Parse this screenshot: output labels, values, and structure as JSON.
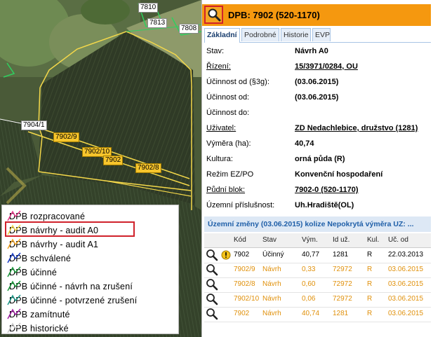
{
  "map": {
    "parcel_labels_top": [
      "7810",
      "7813",
      "7808"
    ],
    "parcel_labels_yellow": [
      "7902/9",
      "7902/10",
      "7902",
      "7902/8"
    ],
    "parcel_label_white_left": "7904/1"
  },
  "legend": {
    "items": [
      {
        "label": "DPB rozpracované",
        "color": "#e8398b"
      },
      {
        "label": "DPB návrhy - audit A0",
        "color": "#f4d84a"
      },
      {
        "label": "DPB návrhy - audit A1",
        "color": "#f5a623"
      },
      {
        "label": "DPB schválené",
        "color": "#1a3ec8"
      },
      {
        "label": "DPB účinné",
        "color": "#1c9b3c"
      },
      {
        "label": "DPB účinné - návrh na zrušení",
        "color": "#1c9b3c"
      },
      {
        "label": "DPB účinné - potvrzené zrušení",
        "color": "#1c9b8a"
      },
      {
        "label": "DPB zamítnuté",
        "color": "#a21fa6"
      },
      {
        "label": "DPB historické",
        "color": "#c8c8c8"
      }
    ]
  },
  "panel": {
    "title": "DPB: 7902 (520-1170)",
    "tabs": [
      "Základní",
      "Podrobné",
      "Historie",
      "EVP"
    ],
    "fields": [
      {
        "key": "Stav:",
        "value": "Návrh A0",
        "key_link": false,
        "val_link": false
      },
      {
        "key": "Řízení:",
        "value": "15/3971/0284, OU",
        "key_link": true,
        "val_link": true
      },
      {
        "key": "Účinnost od (§3g):",
        "value": "(03.06.2015)",
        "key_link": false,
        "val_link": false
      },
      {
        "key": "Účinnost od:",
        "value": "(03.06.2015)",
        "key_link": false,
        "val_link": false
      },
      {
        "key": "Účinnost do:",
        "value": "",
        "key_link": false,
        "val_link": false
      },
      {
        "key": "Uživatel:",
        "value": "ZD Nedachlebice, družstvo (1281)",
        "key_link": true,
        "val_link": true
      },
      {
        "key": "Výměra (ha):",
        "value": "40,74",
        "key_link": false,
        "val_link": false
      },
      {
        "key": "Kultura:",
        "value": "orná půda (R)",
        "key_link": false,
        "val_link": false
      },
      {
        "key": "Režim EZ/PO",
        "value": "Konvenční hospodaření",
        "key_link": false,
        "val_link": false
      },
      {
        "key": "Půdní blok:",
        "value": "7902-0 (520-1170)",
        "key_link": true,
        "val_link": true
      },
      {
        "key": "Územní příslušnost:",
        "value": "Uh.Hradiště(OL)",
        "key_link": false,
        "val_link": false
      }
    ],
    "zmeny_header": "Územní změny (03.06.2015) kolize Nepokrytá výměra UZ: ...",
    "table": {
      "columns": [
        "Kód",
        "Stav",
        "Vým.",
        "Id už.",
        "Kul.",
        "Uč. od"
      ],
      "rows": [
        {
          "kod": "7902",
          "stav": "Účinný",
          "vym": "40,77",
          "id": "1281",
          "kul": "R",
          "od": "22.03.2013",
          "color": "#000000",
          "warn": true
        },
        {
          "kod": "7902/9",
          "stav": "Návrh",
          "vym": "0,33",
          "id": "72972",
          "kul": "R",
          "od": "03.06.2015",
          "color": "#e0900a",
          "warn": false
        },
        {
          "kod": "7902/8",
          "stav": "Návrh",
          "vym": "0,60",
          "id": "72972",
          "kul": "R",
          "od": "03.06.2015",
          "color": "#e0900a",
          "warn": false
        },
        {
          "kod": "7902/10",
          "stav": "Návrh",
          "vym": "0,06",
          "id": "72972",
          "kul": "R",
          "od": "03.06.2015",
          "color": "#e0900a",
          "warn": false
        },
        {
          "kod": "7902",
          "stav": "Návrh",
          "vym": "40,74",
          "id": "1281",
          "kul": "R",
          "od": "03.06.2015",
          "color": "#e0900a",
          "warn": false
        }
      ]
    }
  }
}
